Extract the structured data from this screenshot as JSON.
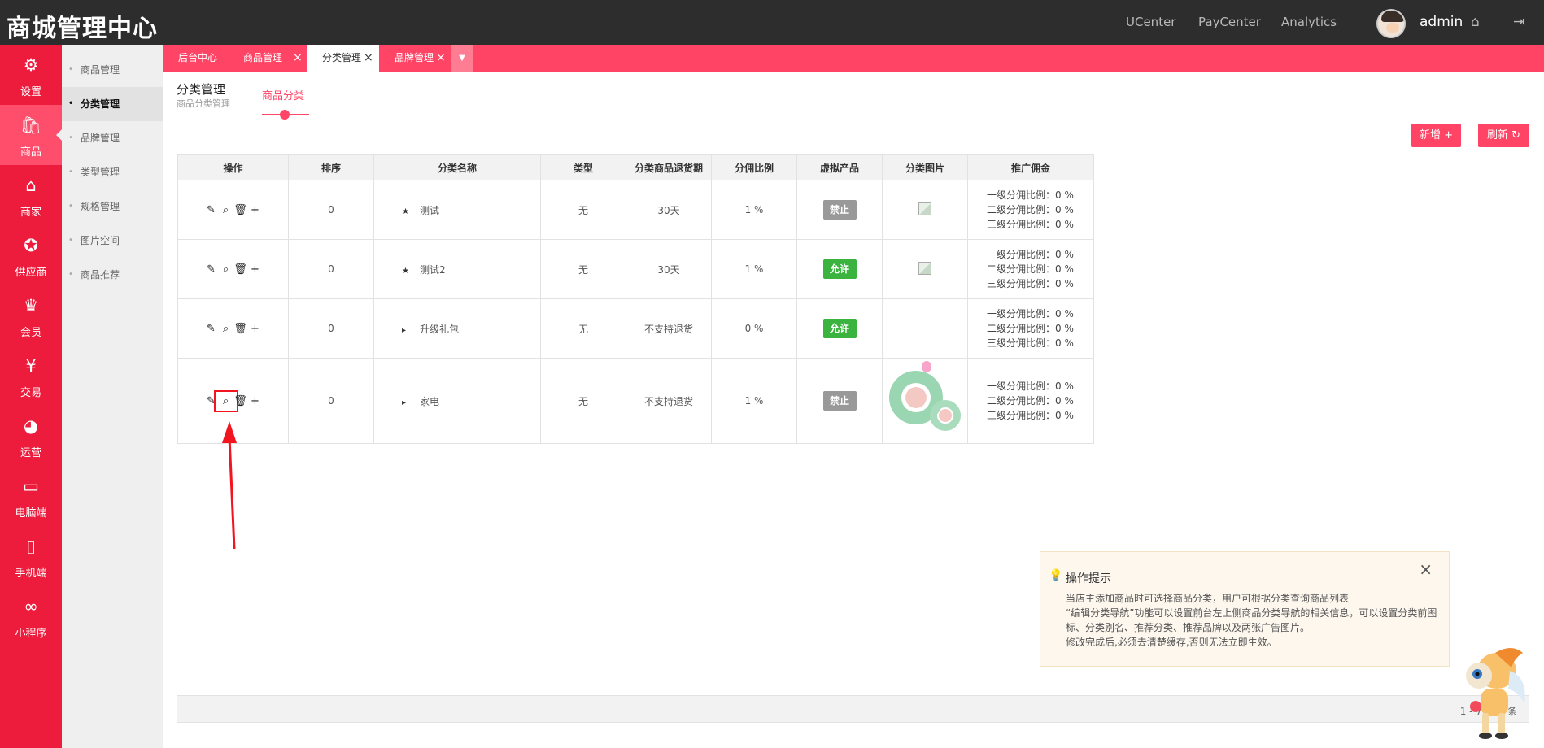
{
  "brand": "商城管理中心",
  "top_nav": [
    "UCenter",
    "PayCenter",
    "Analytics"
  ],
  "user": {
    "name": "admin"
  },
  "icons": {
    "home": "home-icon",
    "logout": "logout-icon"
  },
  "sidebar": [
    {
      "label": "设置",
      "icon": "gear-icon",
      "glyph": "⚙"
    },
    {
      "label": "商品",
      "icon": "shopping-bag-icon",
      "glyph": "👜"
    },
    {
      "label": "商家",
      "icon": "store-icon",
      "glyph": "🏪"
    },
    {
      "label": "供应商",
      "icon": "badge-icon",
      "glyph": "🏅"
    },
    {
      "label": "会员",
      "icon": "crown-icon",
      "glyph": "♛"
    },
    {
      "label": "交易",
      "icon": "yen-icon",
      "glyph": "¥"
    },
    {
      "label": "运营",
      "icon": "pie-chart-icon",
      "glyph": "◕"
    },
    {
      "label": "电脑端",
      "icon": "monitor-icon",
      "glyph": "🖵"
    },
    {
      "label": "手机端",
      "icon": "mobile-icon",
      "glyph": "▯"
    },
    {
      "label": "小程序",
      "icon": "mini-program-icon",
      "glyph": "ꝏ"
    }
  ],
  "submenu": [
    "商品管理",
    "分类管理",
    "品牌管理",
    "类型管理",
    "规格管理",
    "图片空间",
    "商品推荐"
  ],
  "tabs": [
    {
      "label": "后台中心"
    },
    {
      "label": "商品管理"
    },
    {
      "label": "分类管理"
    },
    {
      "label": "品牌管理"
    }
  ],
  "page": {
    "title": "分类管理",
    "subtitle": "商品分类管理",
    "tab": "商品分类"
  },
  "buttons": {
    "add": "新增 +",
    "refresh": "刷新 ↻"
  },
  "table": {
    "headers": [
      "操作",
      "排序",
      "分类名称",
      "类型",
      "分类商品退货期",
      "分佣比例",
      "虚拟产品",
      "分类图片",
      "推广佣金"
    ],
    "rows": [
      {
        "sort": "0",
        "marker": "★",
        "name": "测试",
        "type": "无",
        "return_period": "30天",
        "commission": "1 %",
        "virtual": "禁止",
        "image": "broken",
        "promo": [
          "一级分佣比例：0 %",
          "二级分佣比例：0 %",
          "三级分佣比例：0 %"
        ]
      },
      {
        "sort": "0",
        "marker": "★",
        "name": "测试2",
        "type": "无",
        "return_period": "30天",
        "commission": "1 %",
        "virtual": "允许",
        "image": "broken",
        "promo": [
          "一级分佣比例：0 %",
          "二级分佣比例：0 %",
          "三级分佣比例：0 %"
        ]
      },
      {
        "sort": "0",
        "marker": "▸",
        "name": "升级礼包",
        "type": "无",
        "return_period": "不支持退货",
        "commission": "0 %",
        "virtual": "允许",
        "image": "none",
        "promo": [
          "一级分佣比例：0 %",
          "二级分佣比例：0 %",
          "三级分佣比例：0 %"
        ]
      },
      {
        "sort": "0",
        "marker": "▸",
        "name": "家电",
        "type": "无",
        "return_period": "不支持退货",
        "commission": "1 %",
        "virtual": "禁止",
        "image": "photo",
        "promo": [
          "一级分佣比例：0 %",
          "二级分佣比例：0 %",
          "三级分佣比例：0 %"
        ]
      }
    ]
  },
  "pager": "1 - 7 共 7 条",
  "tip": {
    "title": "操作提示",
    "lines": [
      "当店主添加商品时可选择商品分类，用户可根据分类查询商品列表",
      "“编辑分类导航”功能可以设置前台左上侧商品分类导航的相关信息，可以设置分类前图标、分类别名、推荐分类、推荐品牌以及两张广告图片。",
      "修改完成后,必须去清楚缓存,否则无法立即生效。"
    ]
  },
  "colors": {
    "accent": "#ff4466",
    "sidebar": "#ed1c3d",
    "topbar": "#2d2d2d",
    "allow": "#3ab33f",
    "forbid": "#999999",
    "annotation": "#f2151f"
  }
}
